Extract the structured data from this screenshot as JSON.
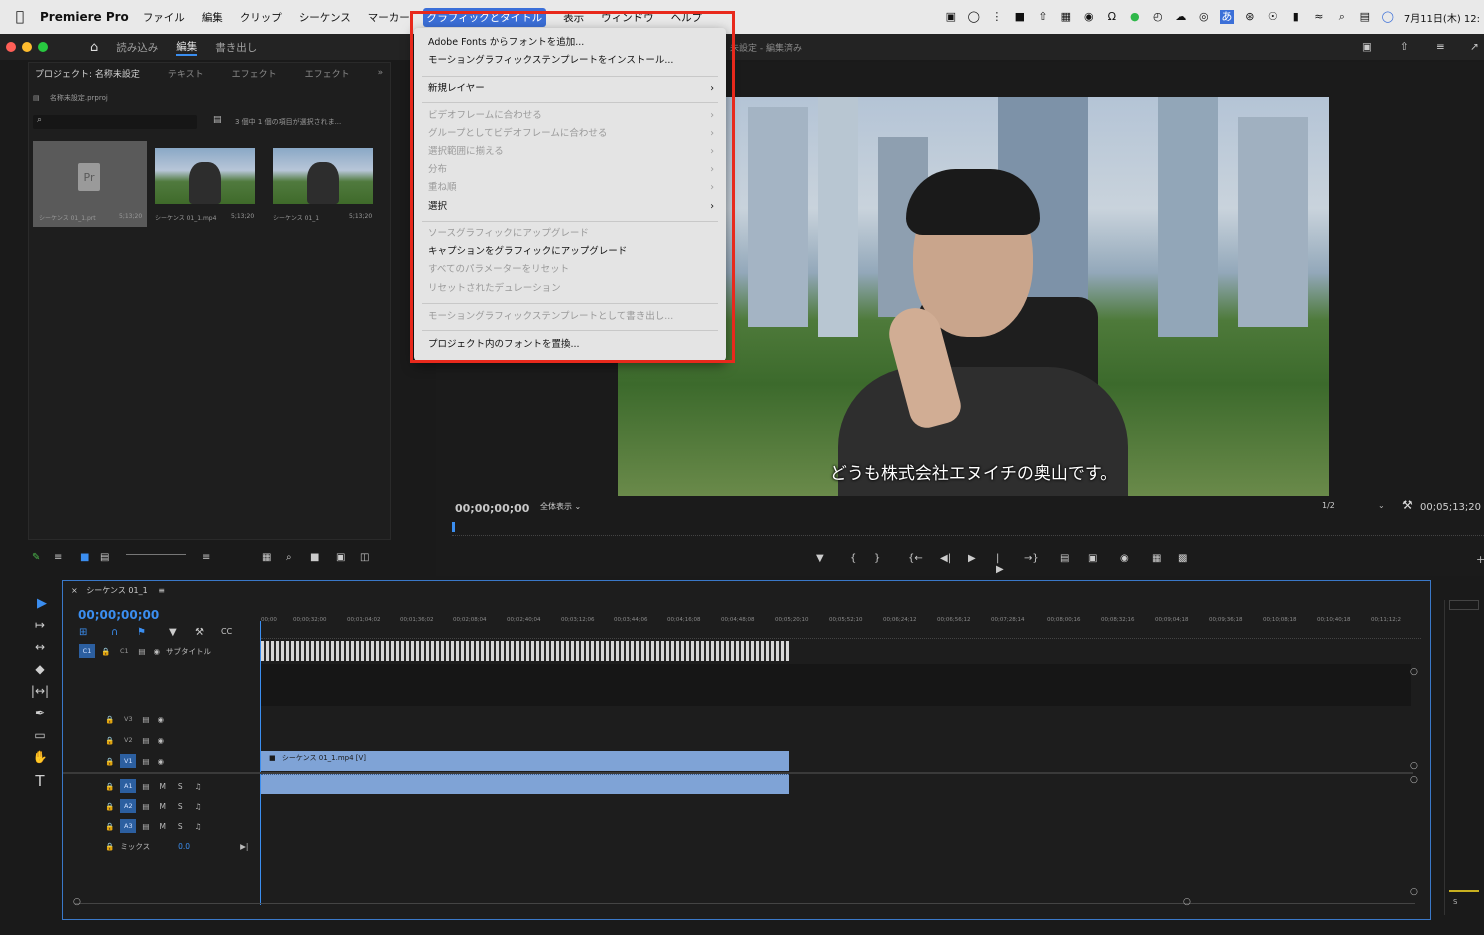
{
  "menubar": {
    "app_name": "Premiere Pro",
    "items": [
      "ファイル",
      "編集",
      "クリップ",
      "シーケンス",
      "マーカー",
      "グラフィックとタイトル",
      "表示",
      "ウィンドウ",
      "ヘルプ"
    ],
    "active_item": "グラフィックとタイトル",
    "clock": "7月11日(木) 12:"
  },
  "app_bar": {
    "tabs": [
      "読み込み",
      "編集",
      "書き出し"
    ],
    "active_tab": "編集",
    "document_title": "未設定 - 編集済み"
  },
  "project_panel": {
    "tabs": [
      "プロジェクト: 名称未設定",
      "テキスト",
      "エフェクト",
      "エフェクト"
    ],
    "overflow": "»",
    "file_name": "名称未設定.prproj",
    "selection_info": "3 個中 1 個の項目が選択されま...",
    "items": [
      {
        "name": "シーケンス 01_1.prt",
        "duration": "5;13;20"
      },
      {
        "name": "シーケンス 01_1.mp4",
        "duration": "5;13;20"
      },
      {
        "name": "シーケンス 01_1",
        "duration": "5;13;20"
      }
    ],
    "thumb_placeholder": "Pr"
  },
  "dropdown": {
    "items": [
      {
        "label": "Adobe Fonts からフォントを追加...",
        "enabled": true,
        "submenu": false
      },
      {
        "label": "モーショングラフィックステンプレートをインストール...",
        "enabled": true,
        "submenu": false
      },
      {
        "label": "新規レイヤー",
        "enabled": true,
        "submenu": true
      },
      {
        "label": "ビデオフレームに合わせる",
        "enabled": false,
        "submenu": true
      },
      {
        "label": "グループとしてビデオフレームに合わせる",
        "enabled": false,
        "submenu": true
      },
      {
        "label": "選択範囲に揃える",
        "enabled": false,
        "submenu": true
      },
      {
        "label": "分布",
        "enabled": false,
        "submenu": true
      },
      {
        "label": "重ね順",
        "enabled": false,
        "submenu": true
      },
      {
        "label": "選択",
        "enabled": true,
        "submenu": true
      },
      {
        "label": "ソースグラフィックにアップグレード",
        "enabled": false,
        "submenu": false
      },
      {
        "label": "キャプションをグラフィックにアップグレード",
        "enabled": true,
        "submenu": false
      },
      {
        "label": "すべてのパラメーターをリセット",
        "enabled": false,
        "submenu": false
      },
      {
        "label": "リセットされたデュレーション",
        "enabled": false,
        "submenu": false
      },
      {
        "label": "モーショングラフィックステンプレートとして書き出し...",
        "enabled": false,
        "submenu": false
      },
      {
        "label": "プロジェクト内のフォントを置換...",
        "enabled": true,
        "submenu": false
      }
    ]
  },
  "program_monitor": {
    "subtitle": "どうも株式会社エヌイチの奥山です。",
    "timecode": "00;00;00;00",
    "zoom": "全体表示",
    "resolution": "1/2",
    "duration": "00;05;13;20"
  },
  "timeline": {
    "sequence_name": "シーケンス 01_1",
    "timecode": "00;00;00;00",
    "subtitle_track": "サブタイトル",
    "ruler": [
      "00;00",
      "00;00;32;00",
      "00;01;04;02",
      "00;01;36;02",
      "00;02;08;04",
      "00;02;40;04",
      "00;03;12;06",
      "00;03;44;06",
      "00;04;16;08",
      "00;04;48;08",
      "00;05;20;10",
      "00;05;52;10",
      "00;06;24;12",
      "00;06;56;12",
      "00;07;28;14",
      "00;08;00;16",
      "00;08;32;16",
      "00;09;04;18",
      "00;09;36;18",
      "00;10;08;18",
      "00;10;40;18",
      "00;11;12;2"
    ],
    "video_tracks": [
      "V3",
      "V2",
      "V1"
    ],
    "audio_tracks": [
      "A1",
      "A2",
      "A3"
    ],
    "mix_label": "ミックス",
    "mix_value": "0.0",
    "clip_label": "シーケンス 01_1.mp4 [V]",
    "m_label": "M",
    "s_label": "S",
    "cc_label": "C1"
  },
  "colors": {
    "accent": "#3b8ef0",
    "highlight_box": "#e8291c",
    "clip": "#7fa3d6"
  }
}
